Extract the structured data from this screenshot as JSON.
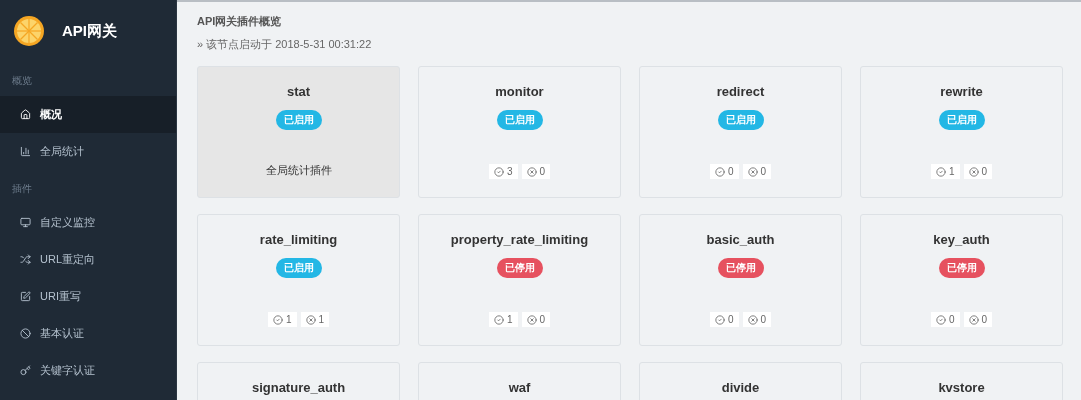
{
  "brand": {
    "title": "API网关"
  },
  "sidebar": {
    "sections": [
      {
        "label": "概览",
        "items": [
          {
            "label": "概况",
            "selected": true
          },
          {
            "label": "全局统计",
            "selected": false
          }
        ]
      },
      {
        "label": "插件",
        "items": [
          {
            "label": "自定义监控",
            "selected": false
          },
          {
            "label": "URL重定向",
            "selected": false
          },
          {
            "label": "URI重写",
            "selected": false
          },
          {
            "label": "基本认证",
            "selected": false
          },
          {
            "label": "关键字认证",
            "selected": false
          }
        ]
      }
    ]
  },
  "header": {
    "title": "API网关插件概览",
    "subtitle": "» 该节点启动于 2018-5-31 00:31:22"
  },
  "plugins": [
    {
      "name": "stat",
      "status": "已启用",
      "enabled": true,
      "highlighted": true,
      "kind": "description",
      "description": "全局统计插件"
    },
    {
      "name": "monitor",
      "status": "已启用",
      "enabled": true,
      "highlighted": false,
      "kind": "stats",
      "success": "3",
      "failure": "0"
    },
    {
      "name": "redirect",
      "status": "已启用",
      "enabled": true,
      "highlighted": false,
      "kind": "stats",
      "success": "0",
      "failure": "0"
    },
    {
      "name": "rewrite",
      "status": "已启用",
      "enabled": true,
      "highlighted": false,
      "kind": "stats",
      "success": "1",
      "failure": "0"
    },
    {
      "name": "rate_limiting",
      "status": "已启用",
      "enabled": true,
      "highlighted": false,
      "kind": "stats",
      "success": "1",
      "failure": "1"
    },
    {
      "name": "property_rate_limiting",
      "status": "已停用",
      "enabled": false,
      "highlighted": false,
      "kind": "stats",
      "success": "1",
      "failure": "0"
    },
    {
      "name": "basic_auth",
      "status": "已停用",
      "enabled": false,
      "highlighted": false,
      "kind": "stats",
      "success": "0",
      "failure": "0"
    },
    {
      "name": "key_auth",
      "status": "已停用",
      "enabled": false,
      "highlighted": false,
      "kind": "stats",
      "success": "0",
      "failure": "0"
    },
    {
      "name": "signature_auth",
      "highlighted": false,
      "kind": "stats"
    },
    {
      "name": "waf",
      "highlighted": false,
      "kind": "stats"
    },
    {
      "name": "divide",
      "highlighted": false,
      "kind": "stats"
    },
    {
      "name": "kvstore",
      "highlighted": false,
      "kind": "stats"
    }
  ]
}
